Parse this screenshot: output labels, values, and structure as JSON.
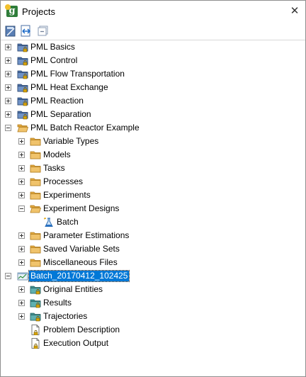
{
  "window": {
    "title": "Projects",
    "app_icon": "gproms-logo-icon",
    "close_label": "✕"
  },
  "toolbar": {
    "buttons": [
      {
        "name": "new-project-icon"
      },
      {
        "name": "link-editor-icon"
      },
      {
        "name": "collapse-all-icon"
      }
    ]
  },
  "tree": {
    "rows": [
      {
        "label": "PML Basics",
        "level": 0,
        "expander": "plus",
        "icon": "library-folder-locked"
      },
      {
        "label": "PML Control",
        "level": 0,
        "expander": "plus",
        "icon": "library-folder-locked"
      },
      {
        "label": "PML Flow Transportation",
        "level": 0,
        "expander": "plus",
        "icon": "library-folder-locked"
      },
      {
        "label": "PML Heat Exchange",
        "level": 0,
        "expander": "plus",
        "icon": "library-folder-locked"
      },
      {
        "label": "PML Reaction",
        "level": 0,
        "expander": "plus",
        "icon": "library-folder-locked"
      },
      {
        "label": "PML Separation",
        "level": 0,
        "expander": "plus",
        "icon": "library-folder-locked"
      },
      {
        "label": "PML Batch Reactor Example",
        "level": 0,
        "expander": "minus",
        "icon": "folder-open"
      },
      {
        "label": "Variable Types",
        "level": 1,
        "expander": "plus",
        "icon": "folder"
      },
      {
        "label": "Models",
        "level": 1,
        "expander": "plus",
        "icon": "folder"
      },
      {
        "label": "Tasks",
        "level": 1,
        "expander": "plus",
        "icon": "folder"
      },
      {
        "label": "Processes",
        "level": 1,
        "expander": "plus",
        "icon": "folder"
      },
      {
        "label": "Experiments",
        "level": 1,
        "expander": "plus",
        "icon": "folder"
      },
      {
        "label": "Experiment Designs",
        "level": 1,
        "expander": "minus",
        "icon": "folder-open"
      },
      {
        "label": "Batch",
        "level": 2,
        "expander": "none",
        "icon": "flask"
      },
      {
        "label": "Parameter Estimations",
        "level": 1,
        "expander": "plus",
        "icon": "folder"
      },
      {
        "label": "Saved Variable Sets",
        "level": 1,
        "expander": "plus",
        "icon": "folder"
      },
      {
        "label": "Miscellaneous Files",
        "level": 1,
        "expander": "plus",
        "icon": "folder"
      },
      {
        "label": "Batch_20170412_102425",
        "level": 0,
        "expander": "minus",
        "icon": "results-case",
        "selected": true
      },
      {
        "label": "Original Entities",
        "level": 1,
        "expander": "plus",
        "icon": "teal-folder-locked"
      },
      {
        "label": "Results",
        "level": 1,
        "expander": "plus",
        "icon": "teal-folder-locked"
      },
      {
        "label": "Trajectories",
        "level": 1,
        "expander": "plus",
        "icon": "teal-folder-locked"
      },
      {
        "label": "Problem Description",
        "level": 1,
        "expander": "none",
        "icon": "document-locked"
      },
      {
        "label": "Execution Output",
        "level": 1,
        "expander": "none",
        "icon": "document-locked"
      }
    ]
  },
  "colors": {
    "library_folder": "#4a6fa5",
    "folder": "#f0c36b",
    "teal_folder": "#5fb0b0",
    "lock": "#d9a400",
    "selection": "#0078d7"
  }
}
